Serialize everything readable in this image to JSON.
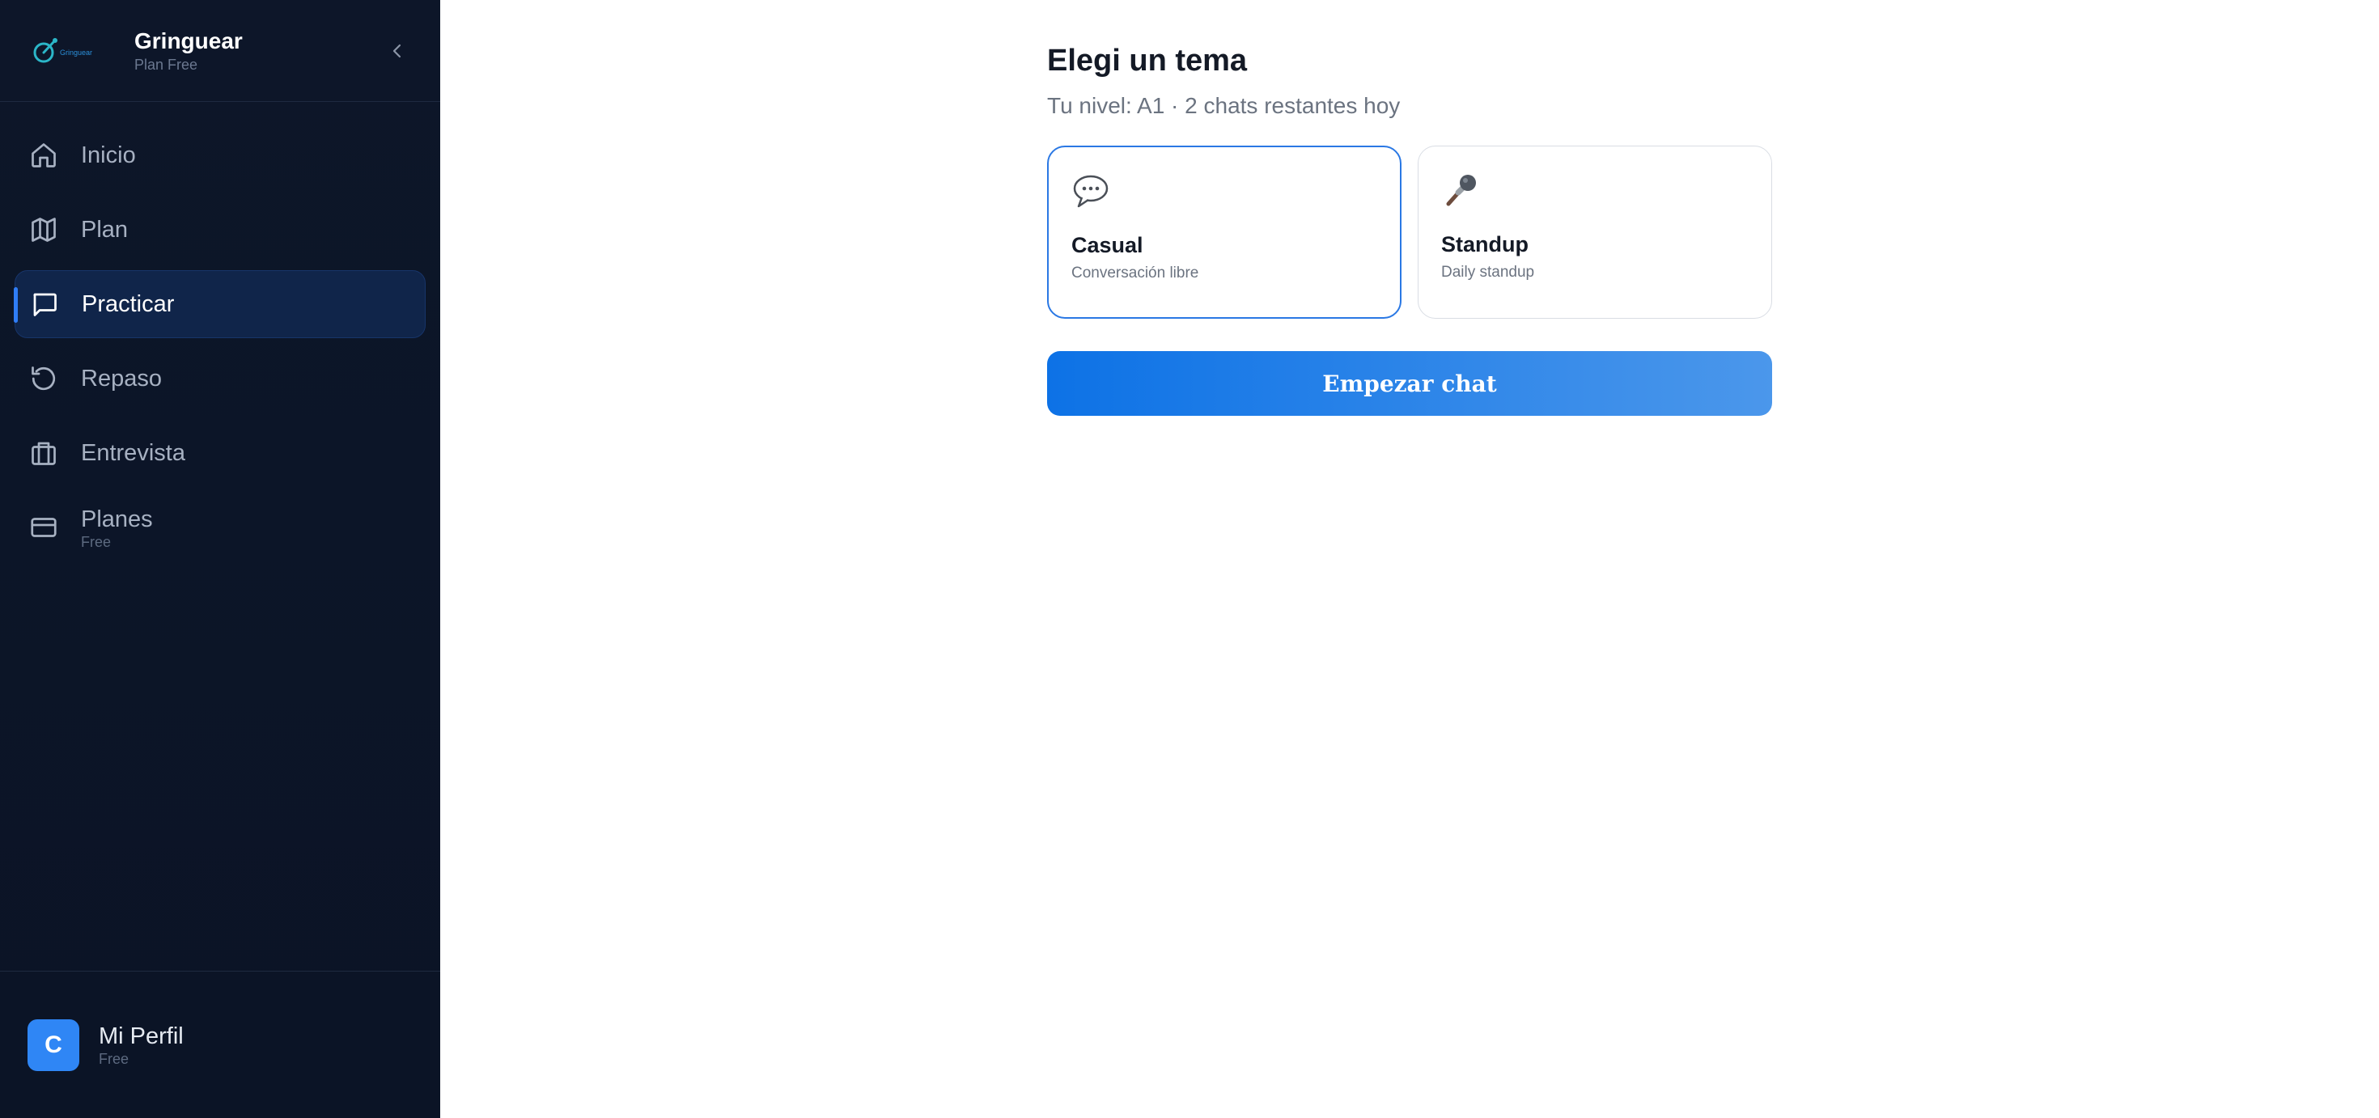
{
  "sidebar": {
    "brand_name": "Gringuear",
    "brand_plan": "Plan Free",
    "logo_text": "Gringuear",
    "items": [
      {
        "label": "Inicio",
        "icon": "home-icon"
      },
      {
        "label": "Plan",
        "icon": "map-icon"
      },
      {
        "label": "Practicar",
        "icon": "chat-icon",
        "active": true
      },
      {
        "label": "Repaso",
        "icon": "history-icon"
      },
      {
        "label": "Entrevista",
        "icon": "briefcase-icon"
      },
      {
        "label": "Planes",
        "sub": "Free",
        "icon": "credit-card-icon"
      }
    ],
    "profile": {
      "avatar_letter": "C",
      "name": "Mi Perfil",
      "plan": "Free"
    }
  },
  "main": {
    "title": "Elegi un tema",
    "subtitle": "Tu nivel: A1 · 2 chats restantes hoy",
    "topics": [
      {
        "title": "Casual",
        "desc": "Conversación libre",
        "icon": "speech-bubble-icon",
        "selected": true
      },
      {
        "title": "Standup",
        "desc": "Daily standup",
        "icon": "microphone-icon",
        "selected": false
      }
    ],
    "start_label": "Empezar chat"
  },
  "colors": {
    "sidebar_bg": "#0d1629",
    "accent": "#2f7df6",
    "button_start": "#0d72e6",
    "button_end": "#4b97eb"
  }
}
